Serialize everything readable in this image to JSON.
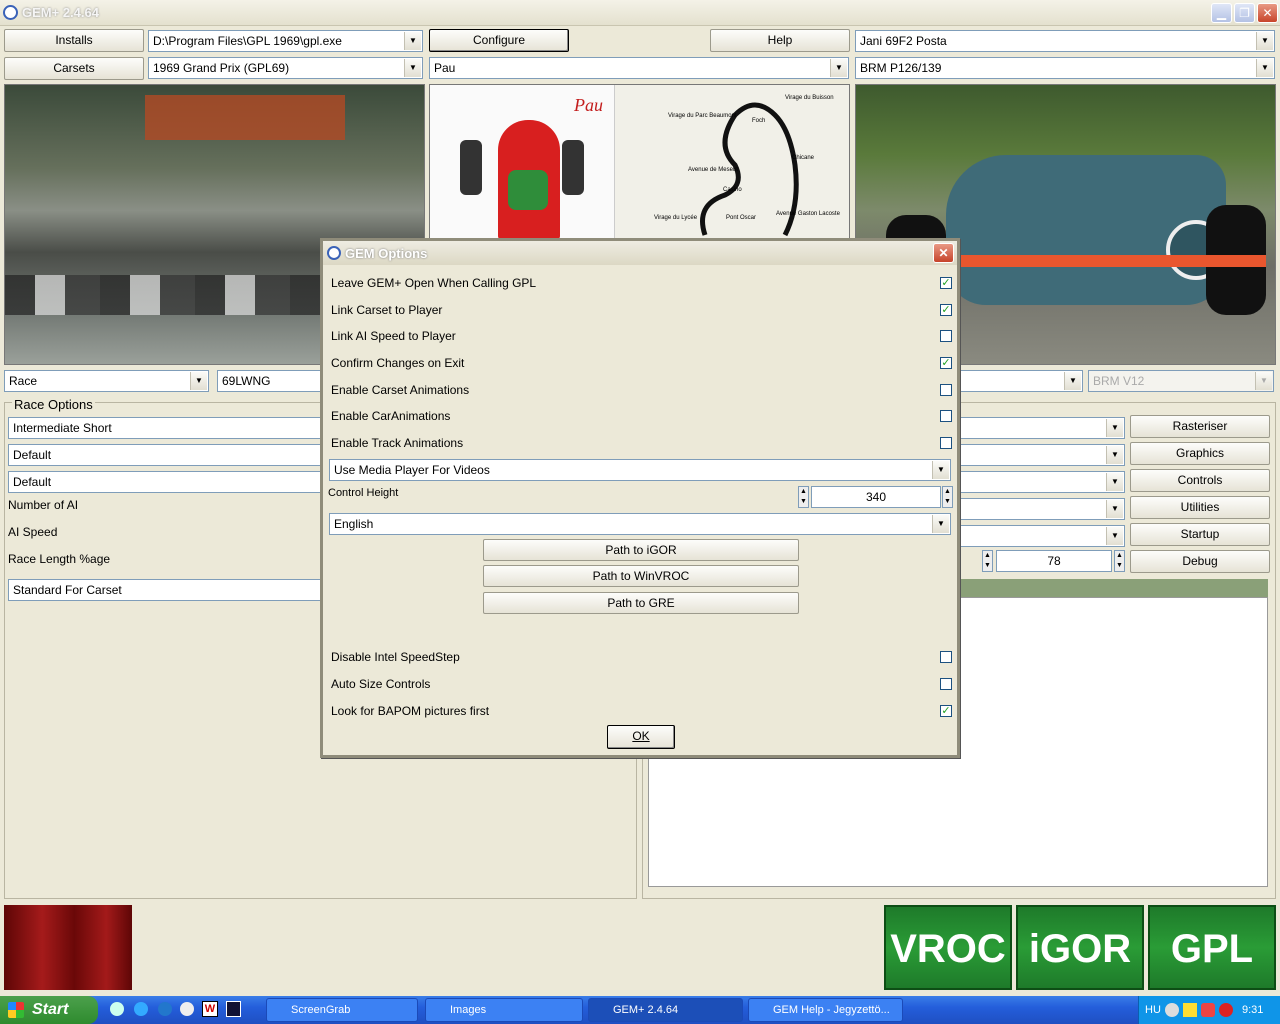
{
  "window": {
    "title": "GEM+ 2.4.64"
  },
  "top": {
    "installs_label": "Installs",
    "carsets_label": "Carsets",
    "install_path": "D:\\Program Files\\GPL 1969\\gpl.exe",
    "carset_value": "1969 Grand Prix (GPL69)",
    "configure_label": "Configure",
    "help_label": "Help",
    "track_value": "Pau",
    "player_value": "Jani 69F2 Posta",
    "car_value": "BRM P126/139"
  },
  "map": {
    "title": "Pau",
    "labels": [
      "Virage du Parc Beaumont",
      "Virage du Buisson",
      "Foch",
      "Chicane",
      "Avenue de Meseut",
      "Casino",
      "Virage du Lycée",
      "Pont Oscar",
      "Avenue Gaston Lacoste"
    ]
  },
  "left_panel": {
    "session_value": "Race",
    "code_value": "69LWNG",
    "race_options_label": "Race Options",
    "fields": [
      "Intermediate Short",
      "Default",
      "Default"
    ],
    "number_ai_label": "Number of AI",
    "ai_speed_label": "AI Speed",
    "race_length_label": "Race Length %age",
    "standard_value": "Standard For Carset"
  },
  "right_panel": {
    "engine_value": "BRM V12",
    "buttons": [
      "Rasteriser",
      "Graphics",
      "Controls",
      "Utilities",
      "Startup",
      "Debug"
    ],
    "spin_value": "78"
  },
  "dialog": {
    "title": "GEM Options",
    "options": [
      {
        "label": "Leave GEM+ Open When Calling GPL",
        "checked": true
      },
      {
        "label": "Link Carset to Player",
        "checked": true
      },
      {
        "label": "Link AI Speed to Player",
        "checked": false
      },
      {
        "label": "Confirm Changes on Exit",
        "checked": true
      },
      {
        "label": "Enable Carset Animations",
        "checked": false
      },
      {
        "label": "Enable CarAnimations",
        "checked": false
      },
      {
        "label": "Enable Track Animations",
        "checked": false
      }
    ],
    "media_player_value": "Use Media Player For Videos",
    "control_height_label": "Control Height",
    "control_height_value": "340",
    "language_value": "English",
    "path_buttons": [
      "Path to iGOR",
      "Path to WinVROC",
      "Path to GRE"
    ],
    "options2": [
      {
        "label": "Disable Intel SpeedStep",
        "checked": false
      },
      {
        "label": "Auto Size Controls",
        "checked": false
      },
      {
        "label": "Look for BAPOM pictures first",
        "checked": true
      }
    ],
    "ok_label": "OK"
  },
  "launch_buttons": [
    "VROC",
    "iGOR",
    "GPL"
  ],
  "taskbar": {
    "start_label": "Start",
    "items": [
      "ScreenGrab",
      "Images",
      "GEM+ 2.4.64",
      "GEM Help - Jegyzettö..."
    ],
    "lang": "HU",
    "clock": "9:31"
  },
  "colors": {
    "accent_green": "#2a9c36",
    "title_blue": "#245edb",
    "flag_red": "#8b0f0f"
  }
}
